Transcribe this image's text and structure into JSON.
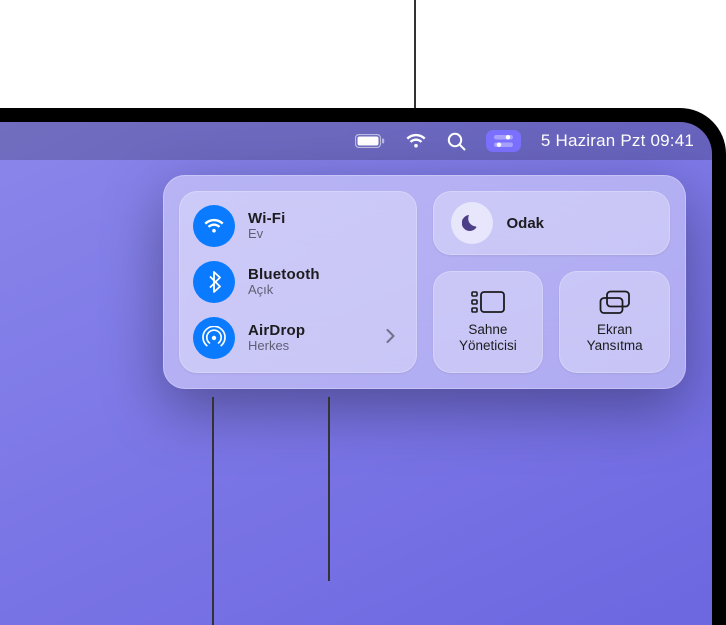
{
  "menubar": {
    "date_time": "5 Haziran Pzt  09:41"
  },
  "control_center": {
    "connectivity": {
      "wifi": {
        "title": "Wi-Fi",
        "sub": "Ev"
      },
      "bluetooth": {
        "title": "Bluetooth",
        "sub": "Açık"
      },
      "airdrop": {
        "title": "AirDrop",
        "sub": "Herkes"
      }
    },
    "focus": {
      "label": "Odak"
    },
    "stage_manager": {
      "label": "Sahne\nYöneticisi"
    },
    "screen_mirroring": {
      "label": "Ekran\nYansıtma"
    }
  }
}
